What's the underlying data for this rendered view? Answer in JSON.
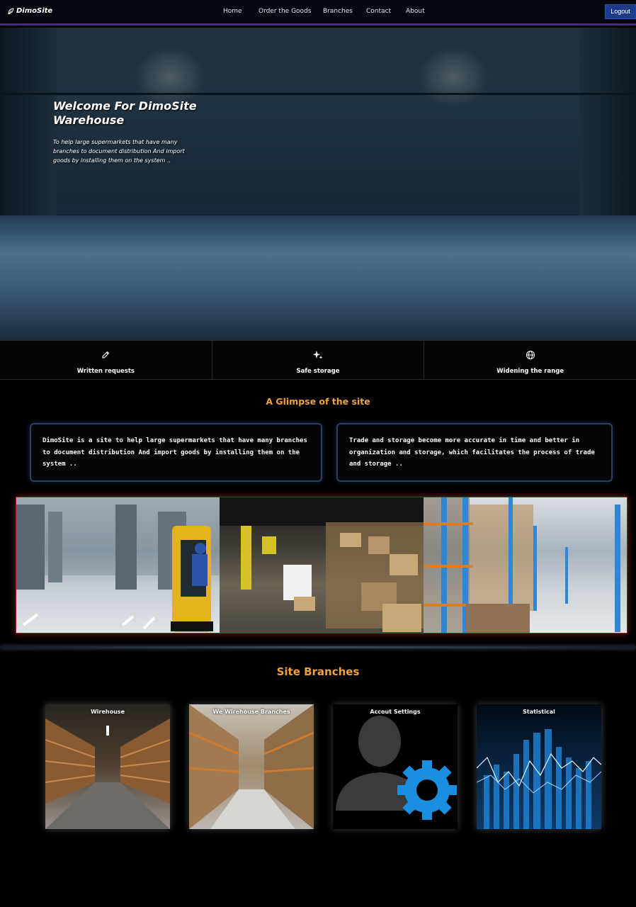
{
  "nav": {
    "brand": "DimoSite",
    "links": [
      "Home",
      "Order the Goods",
      "Branches",
      "Contact",
      "About"
    ],
    "logout_label": "Logout"
  },
  "hero": {
    "title": "Welcome For DimoSite Warehouse",
    "subtitle": "To help large supermarkets that have many branches to document distribution And import goods by installing them on the system .."
  },
  "features": [
    {
      "icon": "pencil-icon",
      "label": "Written requests"
    },
    {
      "icon": "sparkles-icon",
      "label": "Safe storage"
    },
    {
      "icon": "globe-icon",
      "label": "Widening the range"
    }
  ],
  "glimpse": {
    "title": "A Glimpse of the site",
    "box_left": "DimoSite is a site to help large supermarkets that have many branches to document distribution And import goods by installing them on the system ..",
    "box_right": "Trade and storage become more accurate in time and better in organization and storage, which facilitates the process of trade and storage .."
  },
  "branches": {
    "title": "Site Branches",
    "cards": [
      {
        "label": "Wirehouse"
      },
      {
        "label": "We Wirehouse Branches"
      },
      {
        "label": "Accout Settings"
      },
      {
        "label": "Statistical"
      }
    ]
  },
  "colors": {
    "accent_orange": "#f0a13a",
    "logout_blue": "#1e3a8a",
    "nav_border": "#4a2a7a"
  }
}
